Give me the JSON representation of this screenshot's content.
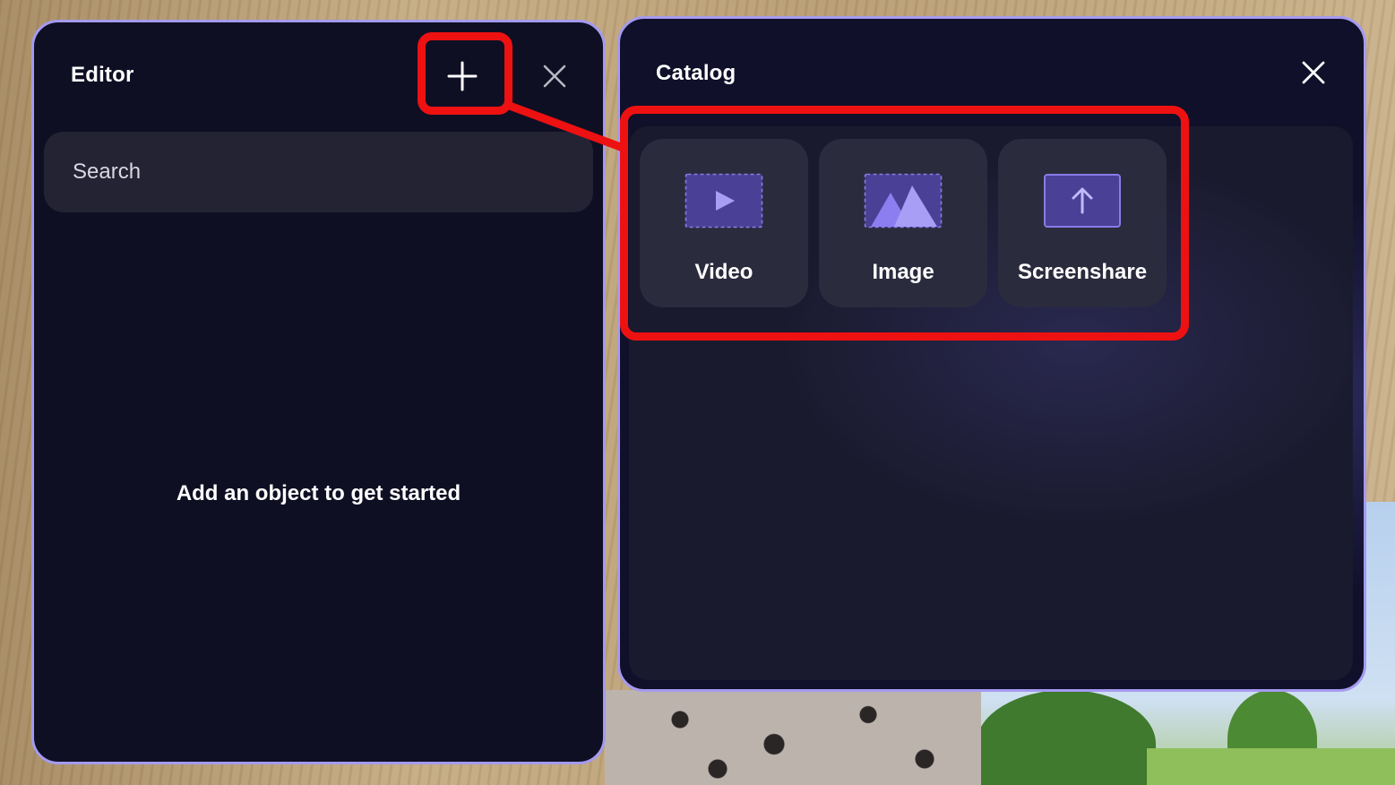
{
  "editor": {
    "title": "Editor",
    "add_icon": "plus-icon",
    "close_icon": "close-icon",
    "search_placeholder": "Search",
    "empty_message": "Add an object to get started"
  },
  "catalog": {
    "title": "Catalog",
    "close_icon": "close-icon",
    "items": [
      {
        "label": "Video",
        "icon": "video-icon"
      },
      {
        "label": "Image",
        "icon": "image-icon"
      },
      {
        "label": "Screenshare",
        "icon": "screenshare-icon"
      }
    ]
  },
  "colors": {
    "panel_bg": "#0f0f24",
    "panel_border": "#a59af0",
    "tile_bg": "#2b2b3e",
    "icon_accent": "#8a7be8",
    "highlight": "#ee1111"
  }
}
